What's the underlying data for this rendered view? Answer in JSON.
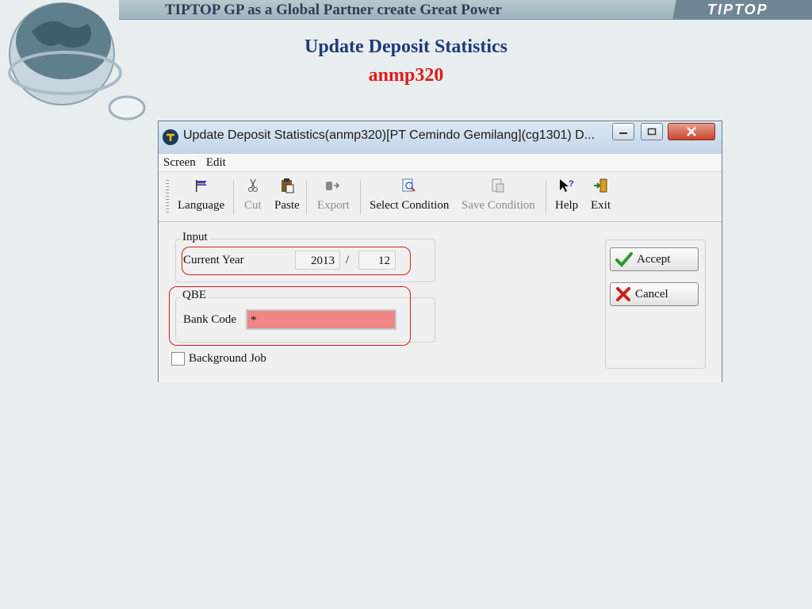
{
  "slide": {
    "header": "TIPTOP GP as a Global Partner create Great Power",
    "logo_text": "TIPTOP",
    "title": "Update Deposit Statistics",
    "subtitle": "anmp320"
  },
  "window": {
    "title": "Update Deposit Statistics(anmp320)[PT Cemindo Gemilang](cg1301)  D...",
    "menu": [
      "Screen",
      "Edit"
    ],
    "toolbar": {
      "language": "Language",
      "cut": "Cut",
      "paste": "Paste",
      "export": "Export",
      "select_condition": "Select Condition",
      "save_condition": "Save Condition",
      "help": "Help",
      "exit": "Exit"
    },
    "input_group": {
      "label": "Input",
      "current_year_label": "Current Year",
      "year": "2013",
      "separator": "/",
      "month": "12"
    },
    "qbe_group": {
      "label": "QBE",
      "bank_code_label": "Bank Code",
      "bank_code": "*"
    },
    "background_job": "Background Job",
    "accept": "Accept",
    "cancel": "Cancel"
  },
  "colors": {
    "highlight": "#e01a1a",
    "required_field": "#f08585",
    "title_blue": "#1f3a7a",
    "subtitle_red": "#e21a1a"
  }
}
